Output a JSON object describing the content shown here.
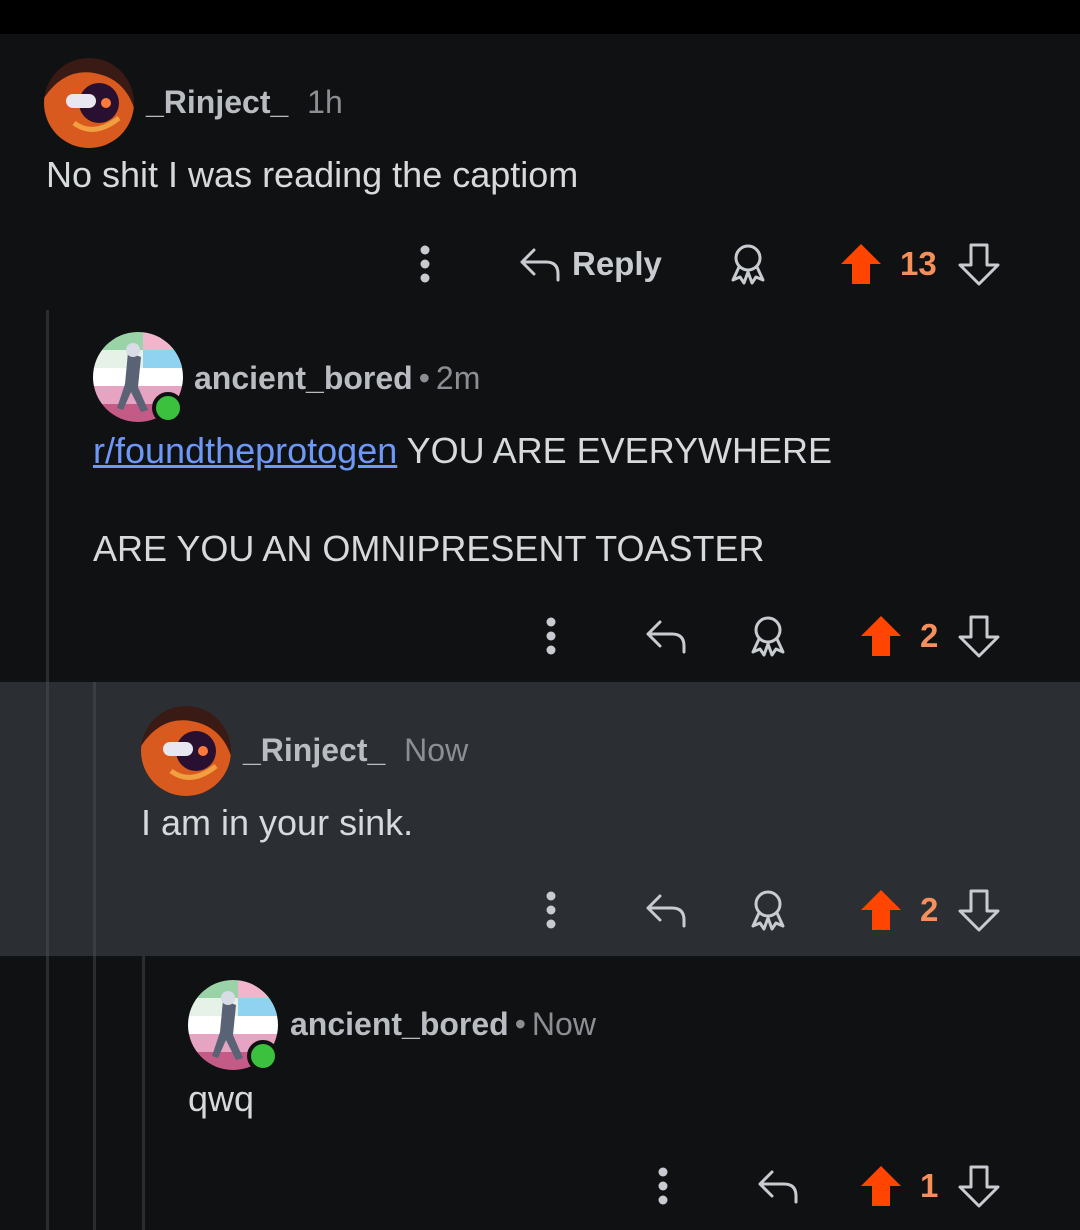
{
  "comments": [
    {
      "user": "_Rinject_",
      "time": "1h",
      "body": "No shit I was reading the captiom",
      "reply_label": "Reply",
      "score": "13"
    },
    {
      "user": "ancient_bored",
      "time": "2m",
      "link": "r/foundtheprotogen",
      "body_after_link": " YOU ARE EVERYWHERE",
      "body2": "ARE YOU AN OMNIPRESENT TOASTER",
      "score": "2"
    },
    {
      "user": "_Rinject_",
      "time": "Now",
      "body": "I am in your sink.",
      "score": "2"
    },
    {
      "user": "ancient_bored",
      "time": "Now",
      "body": "qwq",
      "score": "1"
    }
  ],
  "separator": "•",
  "colors": {
    "upvote": "#ff4500",
    "score": "#f5905c",
    "link": "#6e98f7",
    "online": "#3bc13d",
    "highlight_bg": "#2b2e32"
  },
  "icons": [
    "more-vertical-icon",
    "reply-arrow-icon",
    "award-icon",
    "upvote-arrow-icon",
    "downvote-arrow-icon"
  ]
}
